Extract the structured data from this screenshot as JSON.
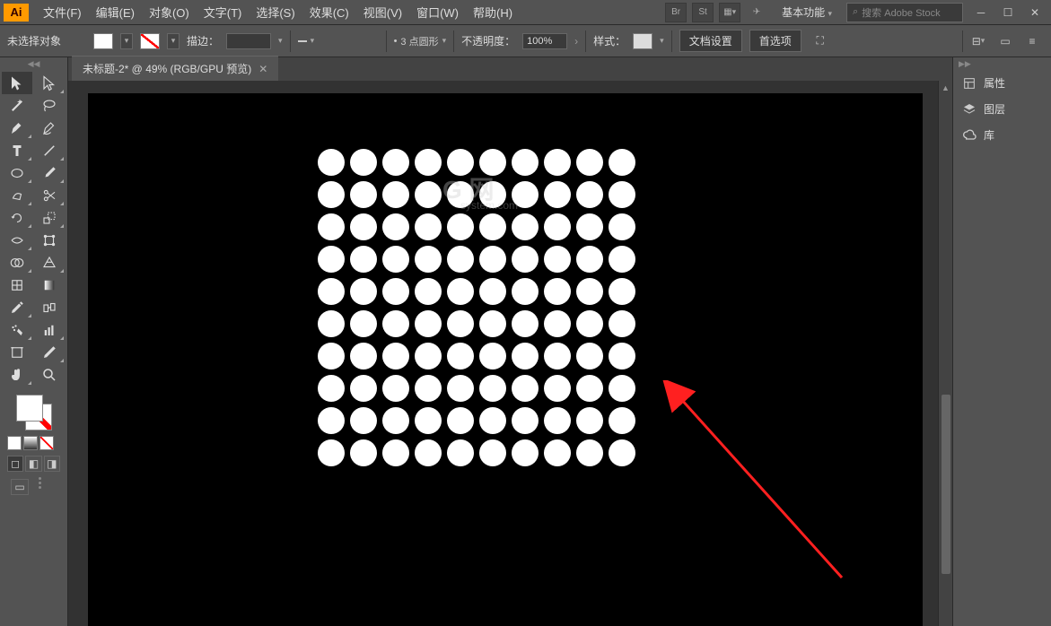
{
  "app": {
    "logo_text": "Ai"
  },
  "menu": {
    "file": "文件(F)",
    "edit": "编辑(E)",
    "object": "对象(O)",
    "type": "文字(T)",
    "select": "选择(S)",
    "effect": "效果(C)",
    "view": "视图(V)",
    "window": "窗口(W)",
    "help": "帮助(H)"
  },
  "workspace": {
    "label": "基本功能"
  },
  "search": {
    "placeholder": "搜索 Adobe Stock"
  },
  "control": {
    "no_selection": "未选择对象",
    "stroke_label": "描边：",
    "stroke_weight": "",
    "stroke_style": "3 点圆形",
    "opacity_label": "不透明度：",
    "opacity_value": "100%",
    "style_label": "样式：",
    "doc_setup": "文档设置",
    "preferences": "首选项"
  },
  "document": {
    "tab_title": "未标题-2* @ 49% (RGB/GPU 预览)"
  },
  "panels": {
    "properties": "属性",
    "layers": "图层",
    "libraries": "库"
  },
  "watermark": {
    "main": "G   网",
    "sub": "system.com"
  },
  "icons": {
    "br": "Br",
    "st": "St"
  }
}
